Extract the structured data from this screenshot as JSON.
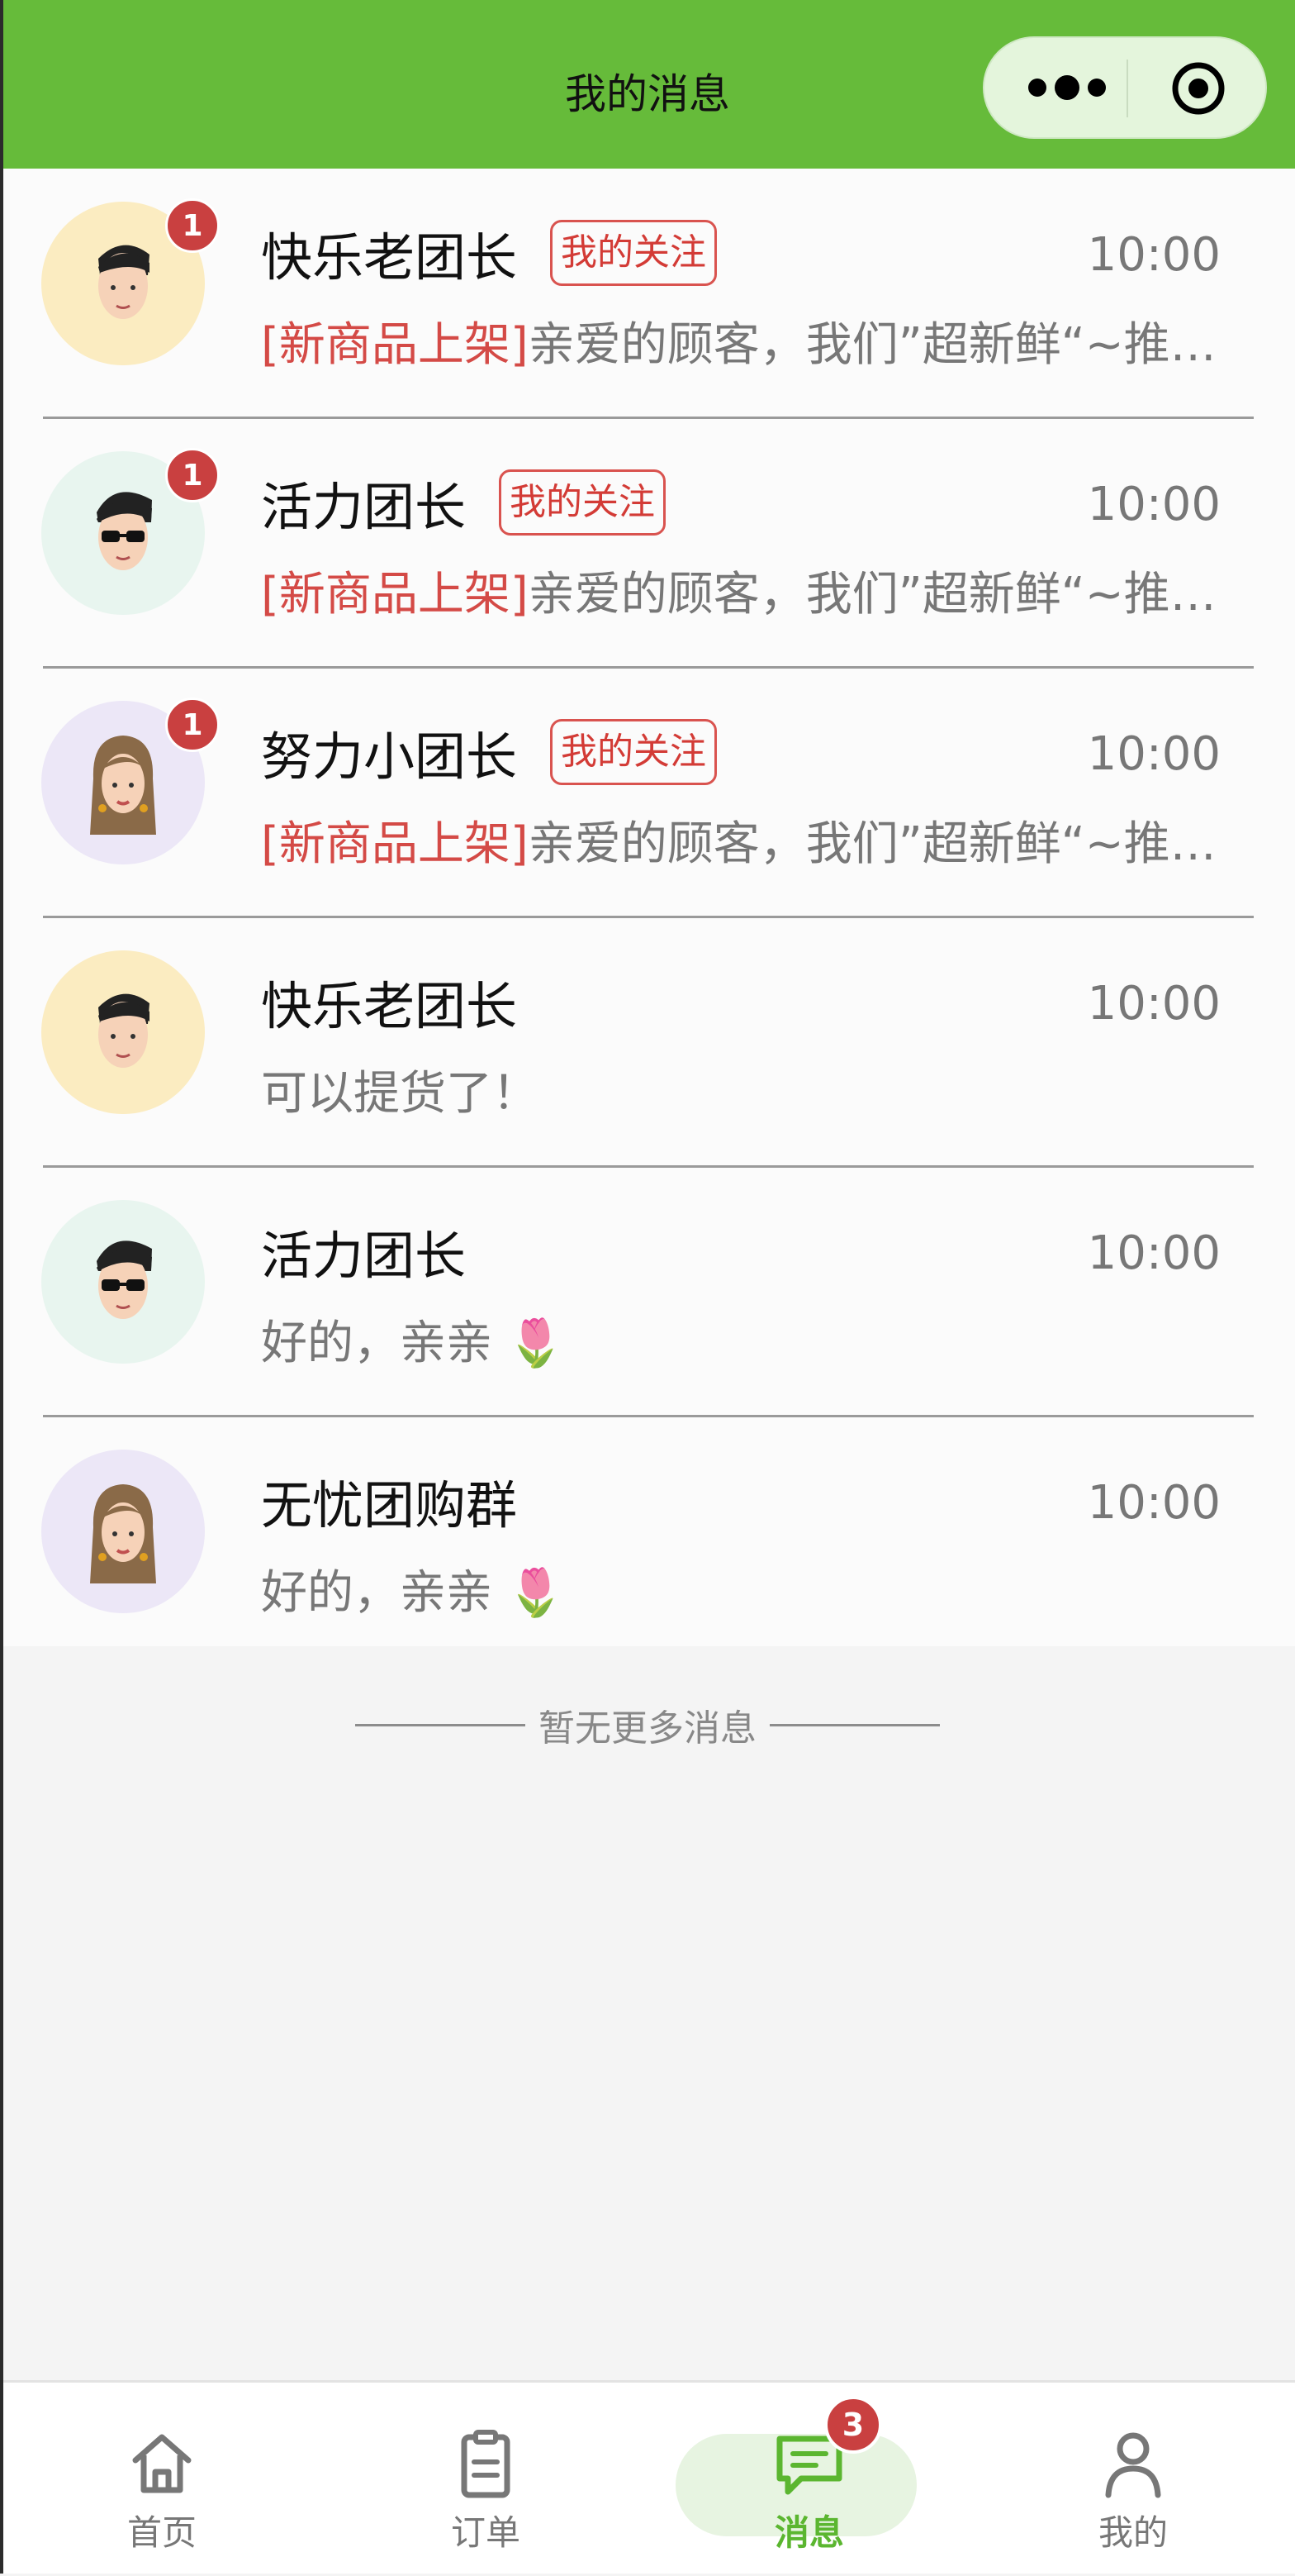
{
  "header": {
    "title": "我的消息"
  },
  "messages": [
    {
      "name": "快乐老团长",
      "tag": "我的关注",
      "time": "10:00",
      "prefix": "[新商品上架]",
      "text": "亲爱的顾客，我们”超新鲜“~推荐…",
      "unread": "1",
      "avatar": "man-icon",
      "avatar_bg": "#fbecc1"
    },
    {
      "name": "活力团长",
      "tag": "我的关注",
      "time": "10:00",
      "prefix": "[新商品上架]",
      "text": "亲爱的顾客，我们”超新鲜“~推荐…",
      "unread": "1",
      "avatar": "man-glasses-icon",
      "avatar_bg": "#e8f5ef"
    },
    {
      "name": "努力小团长",
      "tag": "我的关注",
      "time": "10:00",
      "prefix": "[新商品上架]",
      "text": "亲爱的顾客，我们”超新鲜“~推荐…",
      "unread": "1",
      "avatar": "woman-icon",
      "avatar_bg": "#ece7f7"
    },
    {
      "name": "快乐老团长",
      "tag": "",
      "time": "10:00",
      "prefix": "",
      "text": "可以提货了！",
      "unread": "",
      "avatar": "man-icon",
      "avatar_bg": "#fbecc1"
    },
    {
      "name": "活力团长",
      "tag": "",
      "time": "10:00",
      "prefix": "",
      "text": "好的，亲亲 🌷",
      "unread": "",
      "avatar": "man-glasses-icon",
      "avatar_bg": "#e8f5ef"
    },
    {
      "name": "无忧团购群",
      "tag": "",
      "time": "10:00",
      "prefix": "",
      "text": "好的，亲亲 🌷",
      "unread": "",
      "avatar": "woman-icon",
      "avatar_bg": "#ece7f7"
    }
  ],
  "end_text": "暂无更多消息",
  "tabbar": {
    "home": "首页",
    "orders": "订单",
    "messages": "消息",
    "messages_badge": "3",
    "mine": "我的"
  },
  "colors": {
    "brand": "#66bb3a",
    "badge": "#c94040",
    "tag": "#d33b36",
    "active_tab": "#5bb630"
  }
}
